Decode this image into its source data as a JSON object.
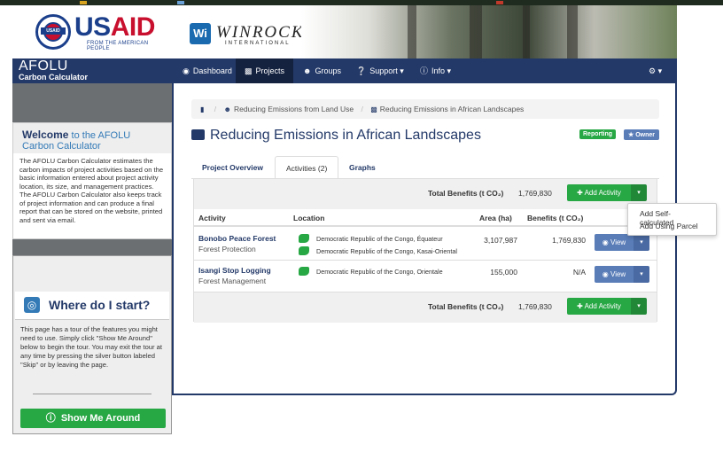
{
  "header": {
    "usaid": {
      "brand_first": "US",
      "brand_second": "AID",
      "tagline": "FROM THE AMERICAN PEOPLE"
    },
    "winrock": {
      "badge": "Wi",
      "name": "WINROCK",
      "sub": "INTERNATIONAL"
    }
  },
  "app": {
    "title": "AFOLU",
    "subtitle": "Carbon Calculator"
  },
  "nav": {
    "items": [
      {
        "label": "Dashboard",
        "icon": "dashboard-icon"
      },
      {
        "label": "Projects",
        "icon": "briefcase-icon"
      },
      {
        "label": "Groups",
        "icon": "users-icon"
      },
      {
        "label": "Support",
        "icon": "question-icon"
      },
      {
        "label": "Info",
        "icon": "info-icon"
      }
    ],
    "settings_icon": "gears-icon"
  },
  "sidebar": {
    "welcome_bold": "Welcome",
    "welcome_rest": "to the AFOLU Carbon Calculator",
    "welcome_text": "The AFOLU Carbon Calculator estimates the carbon impacts of project activities based on the basic information entered about project activity location, its size, and management practices. The AFOLU Carbon Calculator also keeps track of project information and can produce a final report that can be stored on the website, printed and sent via email.",
    "start_title": "Where do I start?",
    "start_text": "This page has a tour of the features you might need to use. Simply click \"Show Me Around\" below to begin the tour. You may exit the tour at any time by pressing the silver button labeled \"Skip\" or by leaving the page.",
    "show_me_label": "Show Me Around"
  },
  "breadcrumb": {
    "items": [
      "Reducing Emissions from Land Use",
      "Reducing Emissions in African Landscapes"
    ]
  },
  "page": {
    "title": "Reducing Emissions in African Landscapes",
    "badge_reporting": "Reporting",
    "badge_owner": "Owner"
  },
  "tabs": [
    "Project Overview",
    "Activities (2)",
    "Graphs"
  ],
  "table": {
    "total_label": "Total Benefits (t CO₂)",
    "total_value": "1,769,830",
    "add_activity_label": "Add Activity",
    "headers": {
      "activity": "Activity",
      "location": "Location",
      "area": "Area (ha)",
      "benefits": "Benefits (t CO₂)"
    },
    "rows": [
      {
        "name": "Bonobo Peace Forest",
        "type": "Forest Protection",
        "locations": [
          "Democratic Republic of the Congo, Équateur",
          "Democratic Republic of the Congo, Kasai-Oriental"
        ],
        "area": "3,107,987",
        "benefits": "1,769,830",
        "view_label": "View"
      },
      {
        "name": "Isangi Stop Logging",
        "type": "Forest Management",
        "locations": [
          "Democratic Republic of the Congo, Orientale"
        ],
        "area": "155,000",
        "benefits": "N/A",
        "view_label": "View"
      }
    ]
  },
  "dropdown": {
    "items": [
      "Add Self-calculated",
      "Add Using Parcel"
    ]
  },
  "colors": {
    "navy": "#233968",
    "green": "#28a745",
    "blue_btn": "#5a7db8"
  }
}
